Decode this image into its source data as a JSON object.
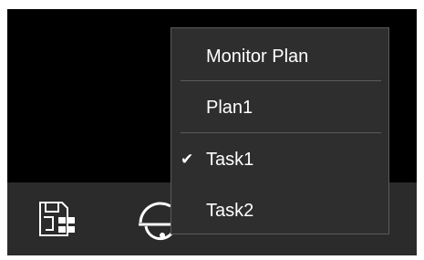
{
  "toolbar": {
    "icons": [
      "storage-grid-icon",
      "dome-camera-icon",
      "partial-icon"
    ]
  },
  "menu": {
    "header": "Monitor Plan",
    "items": [
      {
        "label": "Plan1",
        "checked": false
      },
      {
        "label": "Task1",
        "checked": true
      },
      {
        "label": "Task2",
        "checked": false
      }
    ],
    "check_glyph": "✔"
  },
  "colors": {
    "background": "#000000",
    "toolbar": "#2b2b2b",
    "menu_bg": "#2e2e2e",
    "menu_border": "#5a5a5a",
    "text": "#ffffff"
  }
}
